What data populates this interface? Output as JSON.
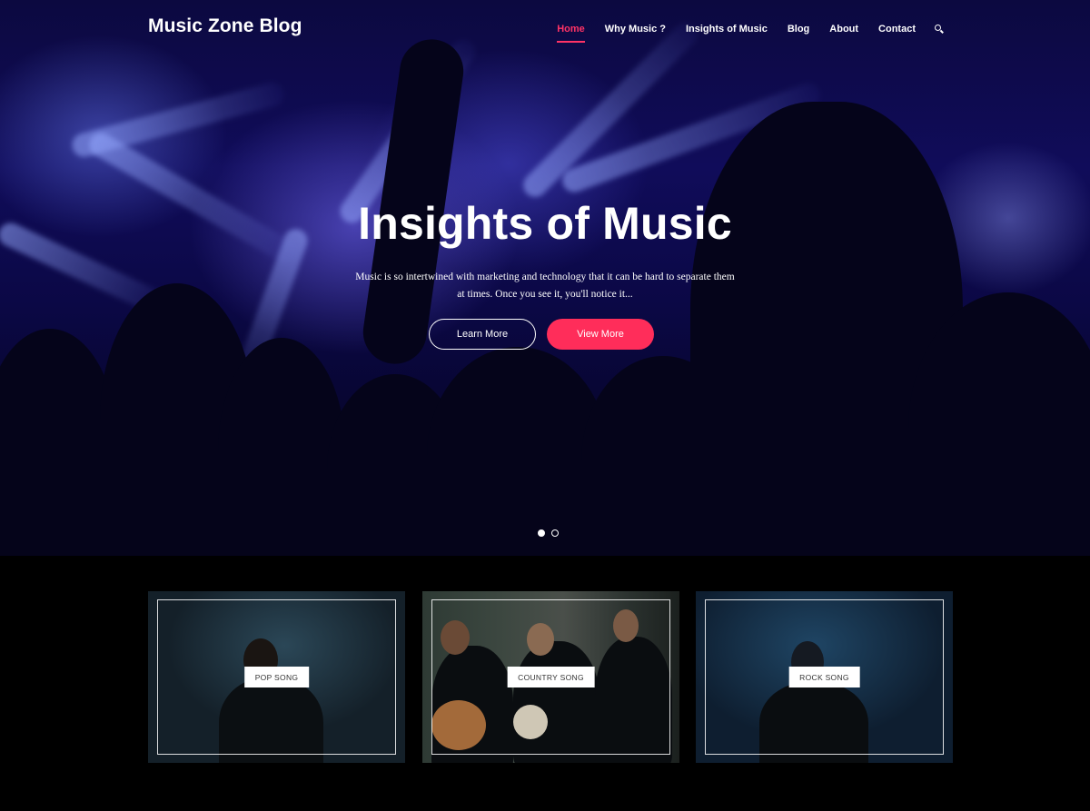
{
  "site": {
    "logo": "Music Zone Blog"
  },
  "nav": {
    "items": [
      {
        "label": "Home",
        "active": true
      },
      {
        "label": "Why Music ?"
      },
      {
        "label": "Insights of Music"
      },
      {
        "label": "Blog"
      },
      {
        "label": "About"
      },
      {
        "label": "Contact"
      }
    ],
    "search_icon": "search-icon"
  },
  "hero": {
    "title": "Insights of Music",
    "text": "Music is so intertwined with marketing and technology that it can be hard to separate them at times. Once you see it, you'll notice it...",
    "buttons": {
      "learn_more": "Learn More",
      "view_more": "View More"
    },
    "slider": {
      "count": 2,
      "active": 1
    }
  },
  "categories": [
    {
      "label": "POP SONG"
    },
    {
      "label": "COUNTRY SONG"
    },
    {
      "label": "ROCK SONG"
    }
  ],
  "colors": {
    "accent": "#ff2d5a",
    "background": "#000000"
  }
}
